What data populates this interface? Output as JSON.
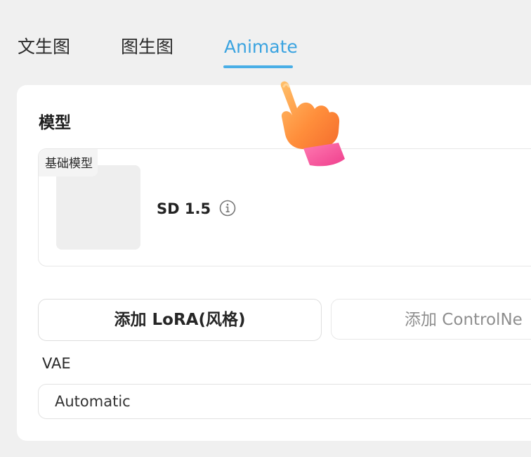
{
  "tabs": [
    {
      "label": "文生图",
      "active": false
    },
    {
      "label": "图生图",
      "active": false
    },
    {
      "label": "Animate",
      "active": true
    }
  ],
  "colors": {
    "active_tab": "#3aa3e0",
    "card_bg": "#ffffff",
    "page_bg": "#f0f0f0"
  },
  "model_section": {
    "title": "模型",
    "base_model_tag": "基础模型",
    "model_name": "SD 1.5",
    "info_icon": "info-circle-icon"
  },
  "buttons": {
    "add_lora": "添加 LoRA(风格)",
    "add_controlnet": "添加 ControlNe"
  },
  "vae": {
    "label": "VAE",
    "value": "Automatic"
  },
  "cursor": {
    "icon": "pointing-hand-cursor-icon"
  }
}
